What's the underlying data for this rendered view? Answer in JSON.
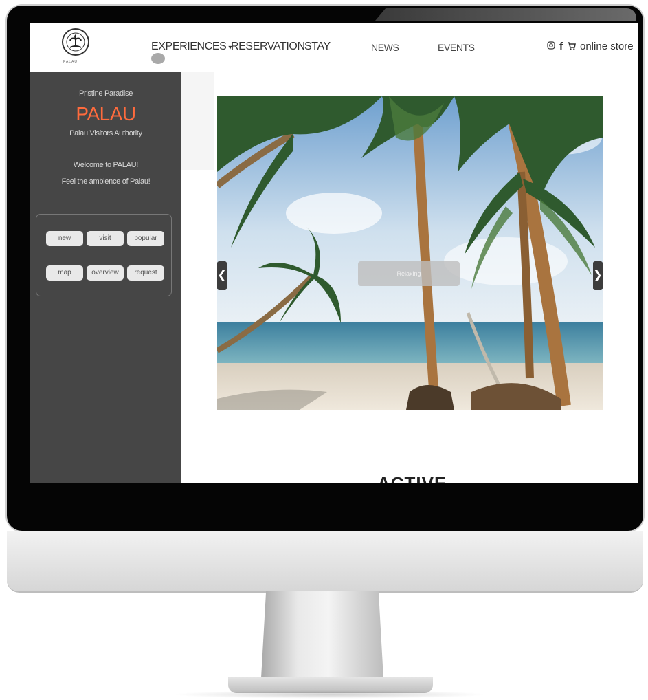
{
  "nav": {
    "logo_caption": "PALAU",
    "items": [
      "EXPERIENCES",
      "RESERVATION",
      "STAY",
      "NEWS",
      "EVENTS"
    ],
    "experiences_caret": "▾",
    "store_label": "online store"
  },
  "dropdown": {
    "items": [
      "",
      "",
      "",
      ""
    ]
  },
  "sidebar": {
    "tagline": "Pristine Paradise",
    "title": "PALAU",
    "subtitle": "Palau Visitors Authority",
    "welcome": "Welcome to PALAU!",
    "feel": "Feel the ambience of Palau!",
    "buttons_row1": [
      "new",
      "visit",
      "popular"
    ],
    "buttons_row2": [
      "map",
      "overview",
      "request"
    ]
  },
  "carousel": {
    "caption": "Relaxing",
    "prev": "❮",
    "next": "❯"
  },
  "section": {
    "heading": "ACTIVE"
  },
  "colors": {
    "accent": "#ff6b3d",
    "sidebar_bg": "#464646"
  }
}
